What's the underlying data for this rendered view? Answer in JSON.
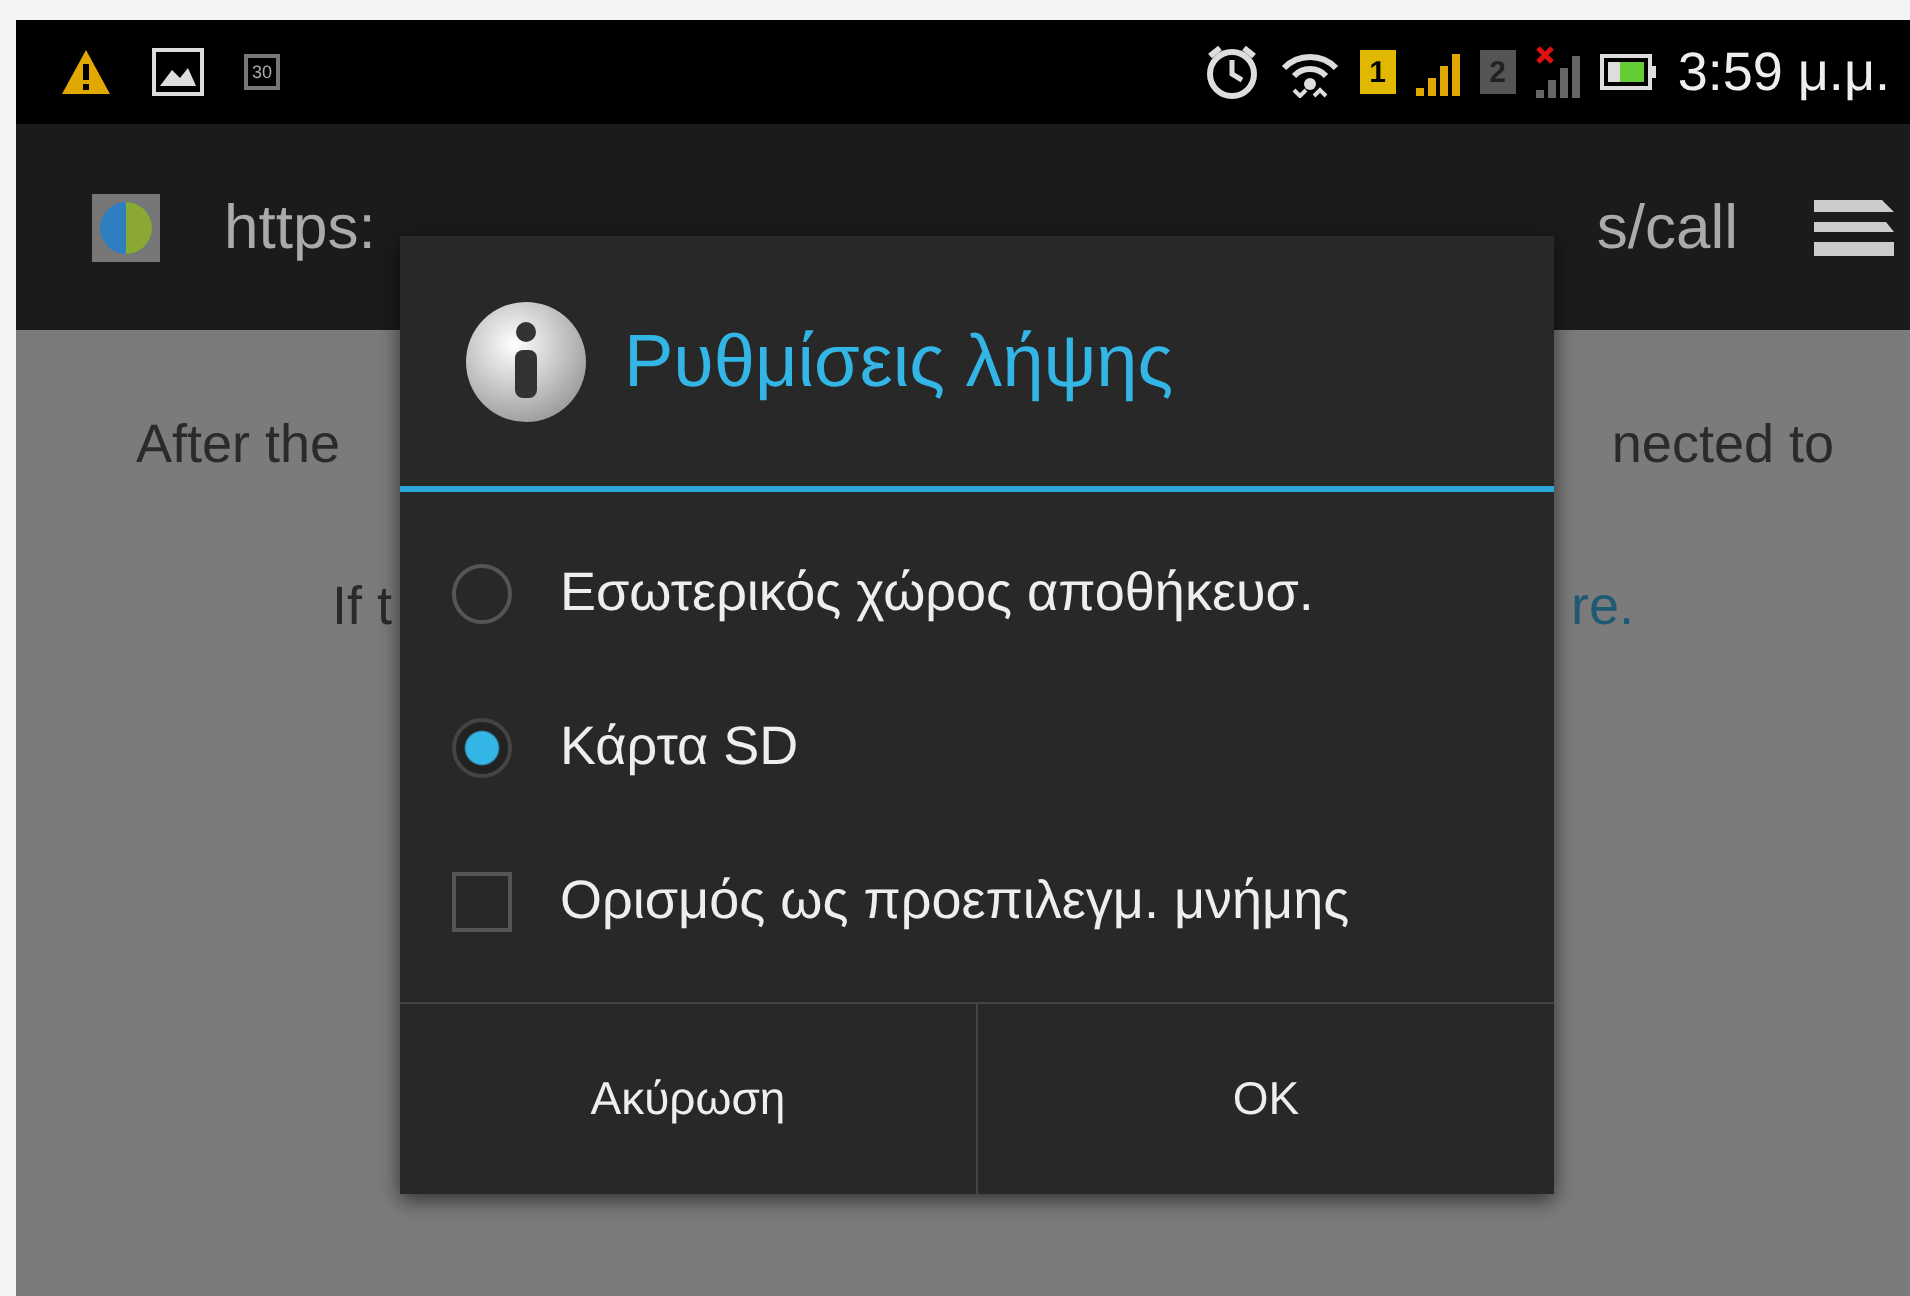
{
  "status_bar": {
    "calendar_day": "30",
    "sim_1": "1",
    "sim_2": "2",
    "time": "3:59 μ.μ."
  },
  "address_bar": {
    "url_start": "https:",
    "url_end": "s/call"
  },
  "page": {
    "lines": [
      {
        "left": "After the",
        "right": "nected to",
        "right_is_link": false
      },
      {
        "left": "If t",
        "right": "re.",
        "right_is_link": true
      }
    ]
  },
  "dialog": {
    "title": "Ρυθμίσεις λήψης",
    "options": [
      {
        "kind": "radio",
        "label": "Εσωτερικός χώρος αποθήκευσ.",
        "selected": false
      },
      {
        "kind": "radio",
        "label": "Κάρτα SD",
        "selected": true
      },
      {
        "kind": "checkbox",
        "label": "Ορισμός ως προεπιλεγμ. μνήμης",
        "checked": false
      }
    ],
    "buttons": [
      "Ακύρωση",
      "OK"
    ]
  }
}
